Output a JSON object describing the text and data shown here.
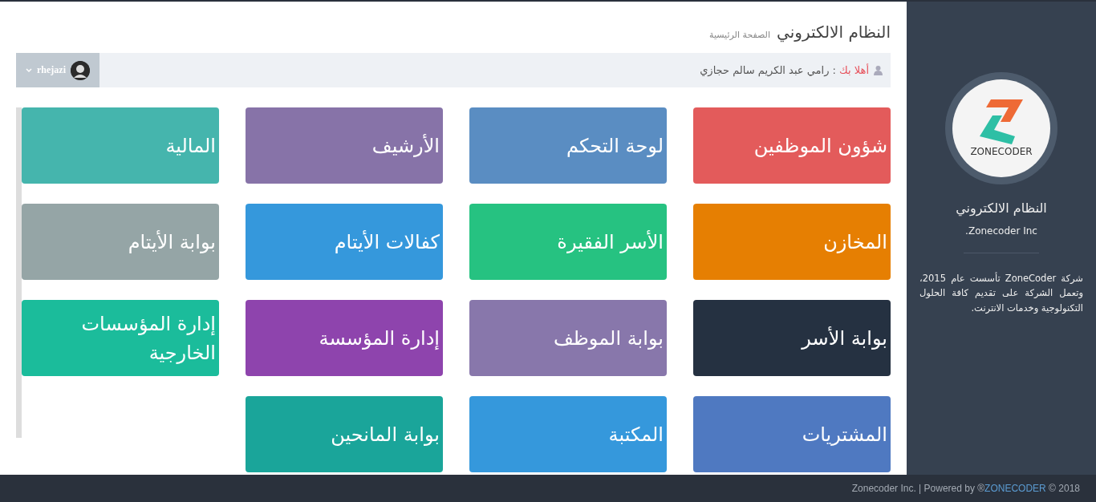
{
  "header": {
    "title": "النظام الالكتروني",
    "subtitle": "الصفحة الرئيسية"
  },
  "welcome": {
    "greeting": "أهلا بك",
    "name": ": رامي عبد الكريم سالم حجازي"
  },
  "user_menu": {
    "username": "rhejazi"
  },
  "tiles": [
    {
      "label": "شؤون الموظفين",
      "color": "#e35b5b"
    },
    {
      "label": "لوحة التحكم",
      "color": "#5a8dc2"
    },
    {
      "label": "الأرشيف",
      "color": "#8773a8"
    },
    {
      "label": "المالية",
      "color": "#45b5ad"
    },
    {
      "label": "المخازن",
      "color": "#e67f02"
    },
    {
      "label": "الأسر الفقيرة",
      "color": "#26c281"
    },
    {
      "label": "كفالات الأيتام",
      "color": "#3598dc"
    },
    {
      "label": "بوابة الأيتام",
      "color": "#95a5a6"
    },
    {
      "label": "بوابة الأسر",
      "color": "#253141"
    },
    {
      "label": "بوابة الموظف",
      "color": "#8877ab"
    },
    {
      "label": "إدارة المؤسسة",
      "color": "#8e44ad"
    },
    {
      "label": "إدارة المؤسسات الخارجية",
      "color": "#1bbc9b"
    },
    {
      "label": "المشتريات",
      "color": "#4f79c1"
    },
    {
      "label": "المكتبة",
      "color": "#3598dc"
    },
    {
      "label": "بوابة المانحين",
      "color": "#1aa59a"
    }
  ],
  "sidebar": {
    "logo_text": "ZONECODER",
    "title": "النظام الالكتروني",
    "company": "Zonecoder Inc.",
    "about": "شركة ZoneCoder تأسست عام 2015، وتعمل الشركة على تقديم كافة الحلول التكنولوجية وخدمات الانترنت."
  },
  "footer": {
    "before": "Zonecoder Inc. | Powered by ®",
    "link": "ZONECODER",
    "after": " © 2018"
  }
}
